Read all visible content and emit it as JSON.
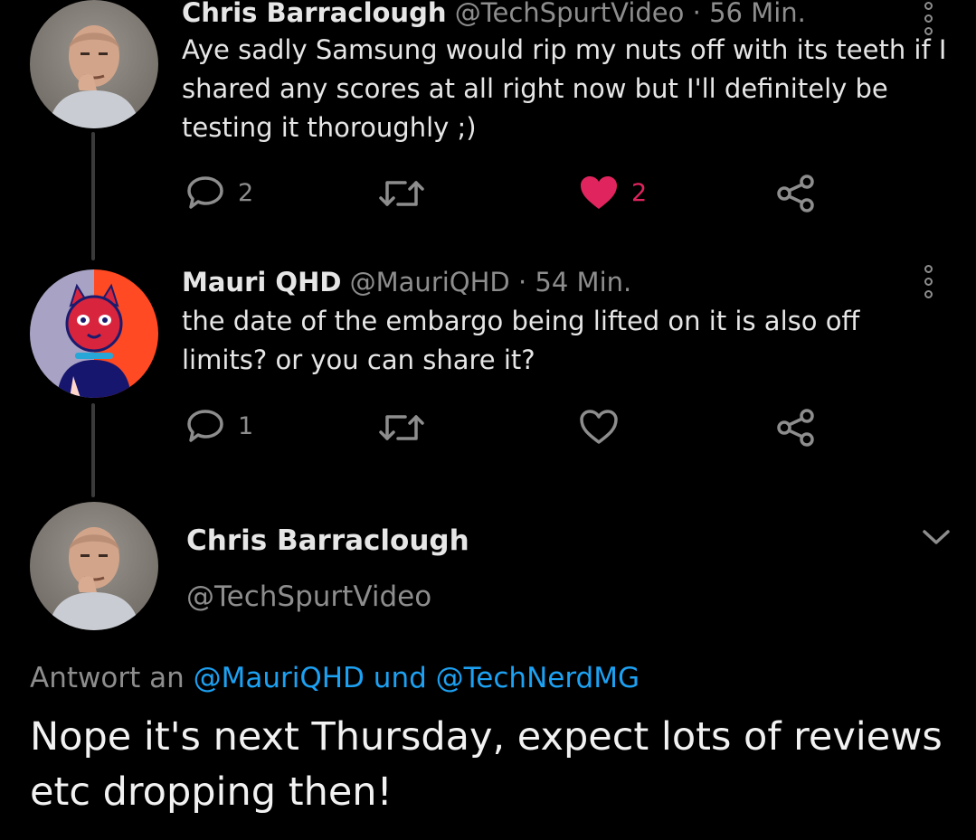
{
  "tweets": [
    {
      "name": "Chris Barraclough",
      "handle": "@TechSpurtVideo",
      "separator": "·",
      "time": "56 Min.",
      "text": "Aye sadly Samsung would rip my nuts off with its teeth if I shared any scores at all right now but I'll definitely be testing it thoroughly ;)",
      "replies": "2",
      "likes": "2",
      "liked": true,
      "avatar": "bald-man-thinking"
    },
    {
      "name": "Mauri QHD",
      "handle": "@MauriQHD",
      "separator": "·",
      "time": "54 Min.",
      "text": "the date of the embargo being lifted on it is also off limits? or you can share it?",
      "replies": "1",
      "likes": "",
      "liked": false,
      "avatar": "stylized-cat-character"
    }
  ],
  "main_tweet": {
    "name": "Chris Barraclough",
    "handle": "@TechSpurtVideo",
    "reply_prefix": "Antwort an",
    "reply_mention_1": "@MauriQHD",
    "reply_conjunction": "und",
    "reply_mention_2": "@TechNerdMG",
    "text": "Nope it's next Thursday, expect lots of reviews etc dropping then!"
  },
  "icons": {
    "reply": "speech-bubble-icon",
    "retweet": "retweet-icon",
    "like": "heart-icon",
    "share": "share-icon",
    "more": "more-vertical-icon",
    "expand": "chevron-down-icon"
  },
  "colors": {
    "background": "#000000",
    "muted": "#8d8d8d",
    "like": "#e0245e",
    "mention": "#1da1f2"
  }
}
